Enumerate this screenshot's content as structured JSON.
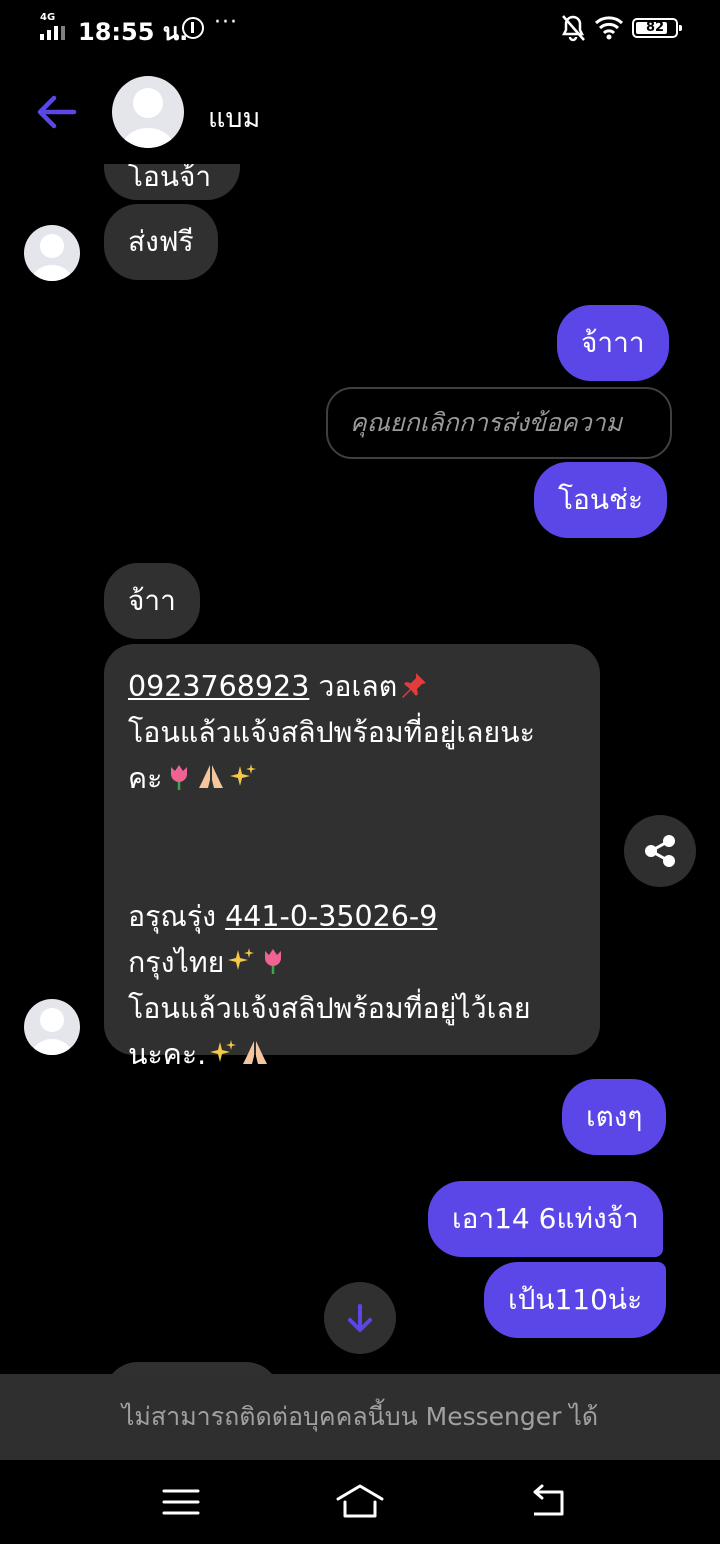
{
  "status_bar": {
    "network": "4G",
    "time": "18:55 น.",
    "overflow": "···",
    "battery": "82",
    "battery_level_pct": 82
  },
  "header": {
    "contact_name": "แบม"
  },
  "messages": {
    "partial_top": "โอนจ้า",
    "free_shipping": "ส่งฟรี",
    "out_1": "จ้าาา",
    "unsent_notice": "คุณยกเลิกการส่งข้อความ",
    "out_2": "โอนช่ะ",
    "in_ok": "จ้าา",
    "payment": {
      "phone": "0923768923",
      "wallet": " วอเลต",
      "line2": "โอนแล้วแจ้งสลิปพร้อมที่อยู่เลยนะ",
      "line3": "คะ",
      "bank_name_prefix": "อรุณรุ่ง ",
      "account": "441-0-35026-9",
      "bank": "กรุงไทย",
      "line7": "โอนแล้วแจ้งสลิปพร้อมที่อยู่ไว้เลย",
      "line8": "นะคะ."
    },
    "out_3": "เตงๆ",
    "out_4": "เอา14 6แท่งจ้า",
    "out_5": "เป้น110น่ะ"
  },
  "banner": {
    "text": "ไม่สามารถติดต่อบุคคลนี้บน Messenger ได้"
  },
  "colors": {
    "accent": "#5b46e7",
    "incoming_bubble": "#303030",
    "background": "#000000"
  },
  "icons": [
    "back-arrow-icon",
    "share-icon",
    "arrow-down-icon",
    "menu-icon",
    "home-icon",
    "return-icon",
    "wifi-icon",
    "bell-off-icon",
    "battery-icon"
  ]
}
